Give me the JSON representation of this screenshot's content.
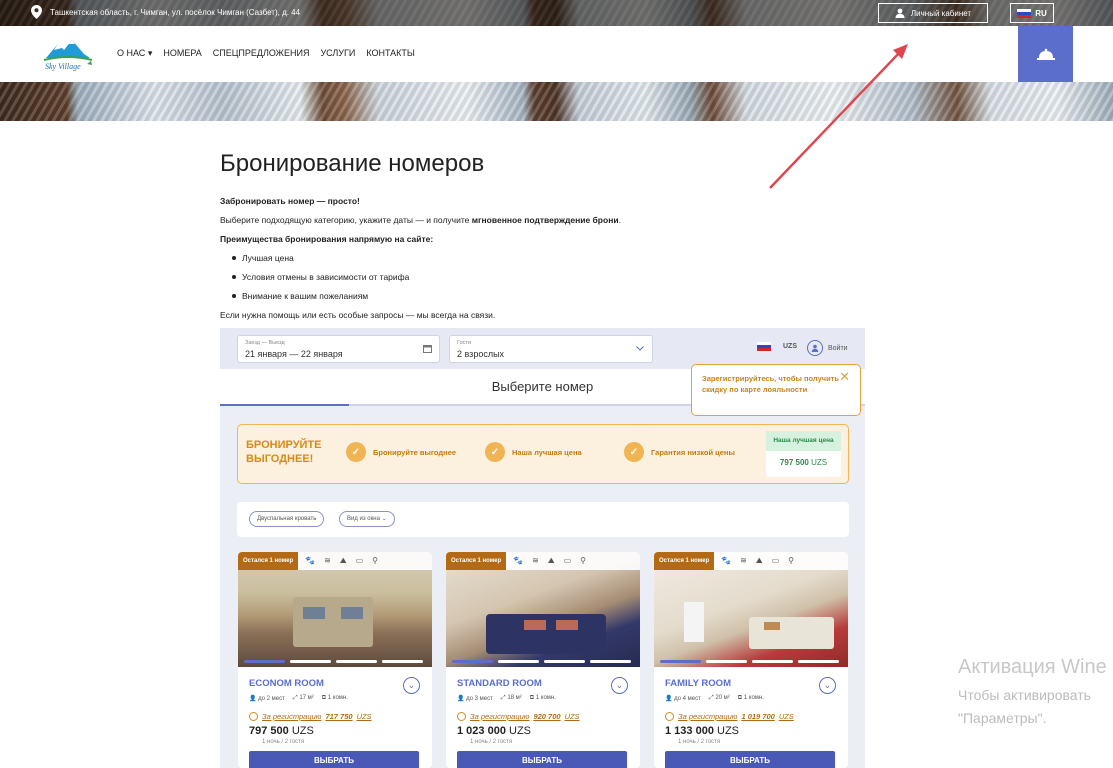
{
  "topbar": {
    "address": "Ташкентская область, г. Чимган, ул. посёлок Чимган (Сазбет), д. 44",
    "cabinet": "Личный кабинет",
    "lang": "RU"
  },
  "logo": {
    "text": "Sky Village"
  },
  "nav": [
    "О НАС",
    "НОМЕРА",
    "СПЕЦПРЕДЛОЖЕНИЯ",
    "УСЛУГИ",
    "КОНТАКТЫ"
  ],
  "page": {
    "title": "Бронирование номеров",
    "p1": "Забронировать номер — просто!",
    "p2a": "Выберите подходящую категорию, укажите даты — и получите ",
    "p2b": "мгновенное подтверждение брони",
    "p2c": ".",
    "p3": "Преимущества бронирования напрямую на сайте:",
    "bullets": [
      "Лучшая цена",
      "Условия отмены в зависимости от тарифа",
      "Внимание к вашим пожеланиям"
    ],
    "p4": "Если нужна помощь или есть особые запросы — мы всегда на связи."
  },
  "booking": {
    "dates_label": "Заезд — Выезд",
    "dates_value": "21 января — 22 января",
    "guests_label": "Гости",
    "guests_value": "2 взрослых",
    "currency": "UZS",
    "login": "Войти",
    "choose": "Выберите номер",
    "tooltip": "Зарегистрируйтесь, чтобы получить скидку по карте лояльности",
    "promo_title_1": "БРОНИРУЙТЕ",
    "promo_title_2": "ВЫГОДНЕЕ!",
    "features": [
      "Бронируйте выгоднее",
      "Наша лучшая цена",
      "Гарантия низкой цены"
    ],
    "best_label": "Наша лучшая цена",
    "best_price": "797 500",
    "best_cur": "UZS",
    "filters": [
      "Двуспальная кровать",
      "Вид из окна"
    ]
  },
  "rooms": [
    {
      "badge": "Остался 1 номер",
      "name": "ECONOM ROOM",
      "guests": "до 2 мест",
      "area": "17 м²",
      "rooms": "1 комн.",
      "reg_label": "За регистрацию",
      "reg_price": "717 750",
      "reg_cur": "UZS",
      "price": "797 500",
      "cur": "UZS",
      "night": "1 ночь / 2 гостя",
      "button": "ВЫБРАТЬ"
    },
    {
      "badge": "Остался 1 номер",
      "name": "STANDARD ROOM",
      "guests": "до 3 мест",
      "area": "18 м²",
      "rooms": "1 комн.",
      "reg_label": "За регистрацию",
      "reg_price": "920 700",
      "reg_cur": "UZS",
      "price": "1 023 000",
      "cur": "UZS",
      "night": "1 ночь / 2 гостя",
      "button": "ВЫБРАТЬ"
    },
    {
      "badge": "Остался 1 номер",
      "name": "FAMILY ROOM",
      "guests": "до 4 мест",
      "area": "20 м²",
      "rooms": "1 комн.",
      "reg_label": "За регистрацию",
      "reg_price": "1 019 700",
      "reg_cur": "UZS",
      "price": "1 133 000",
      "cur": "UZS",
      "night": "1 ночь / 2 гостя",
      "button": "ВЫБРАТЬ"
    }
  ],
  "windows": {
    "line1": "Активация Wine",
    "line2": "Чтобы активировать",
    "line3": "\"Параметры\"."
  }
}
